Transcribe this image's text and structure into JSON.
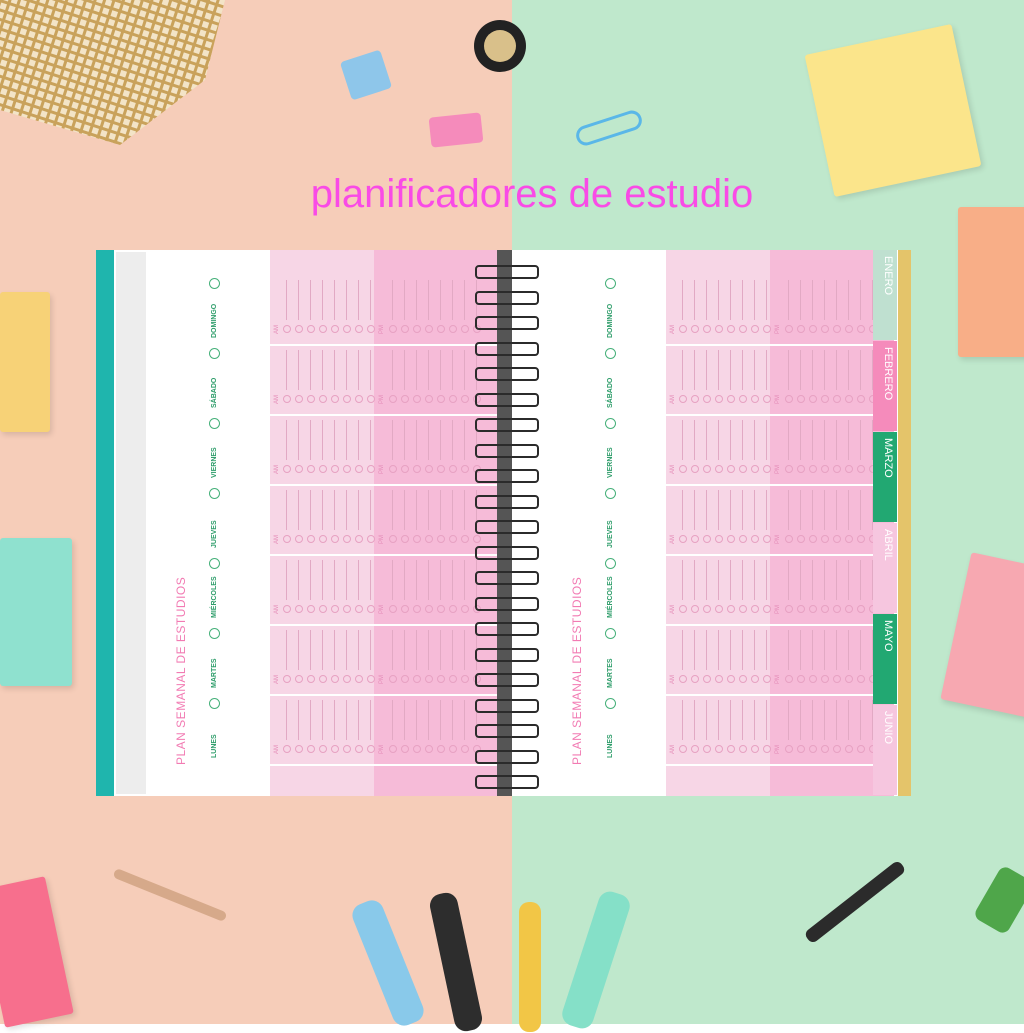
{
  "title": "planificadores de estudio",
  "colors": {
    "background_left": "#f6cdb9",
    "background_right": "#bfe8cc",
    "title": "#f94be6",
    "accent_green": "#2e9d6a",
    "accent_pink": "#f27bb3"
  },
  "planner": {
    "heading": "PLAN SEMANAL DE ESTUDIOS",
    "days": [
      "DOMINGO",
      "SÁBADO",
      "VIERNES",
      "JUEVES",
      "MIÉRCOLES",
      "MARTES",
      "LUNES"
    ],
    "am_label": "AM",
    "pm_label": "PM"
  },
  "month_tabs": [
    {
      "label": "ENERO",
      "color": "#bfe0d0"
    },
    {
      "label": "FEBRERO",
      "color": "#f58bbb"
    },
    {
      "label": "MARZO",
      "color": "#22a872"
    },
    {
      "label": "ABRIL",
      "color": "#f6c6df"
    },
    {
      "label": "MAYO",
      "color": "#22a872"
    },
    {
      "label": "JUNIO",
      "color": "#f6c6df"
    }
  ],
  "icons": [
    "binder-clip-icon",
    "paper-clip-icon",
    "pen-icon",
    "marker-icon",
    "sticky-note-icon",
    "grid-notebook-icon",
    "tape-icon"
  ]
}
